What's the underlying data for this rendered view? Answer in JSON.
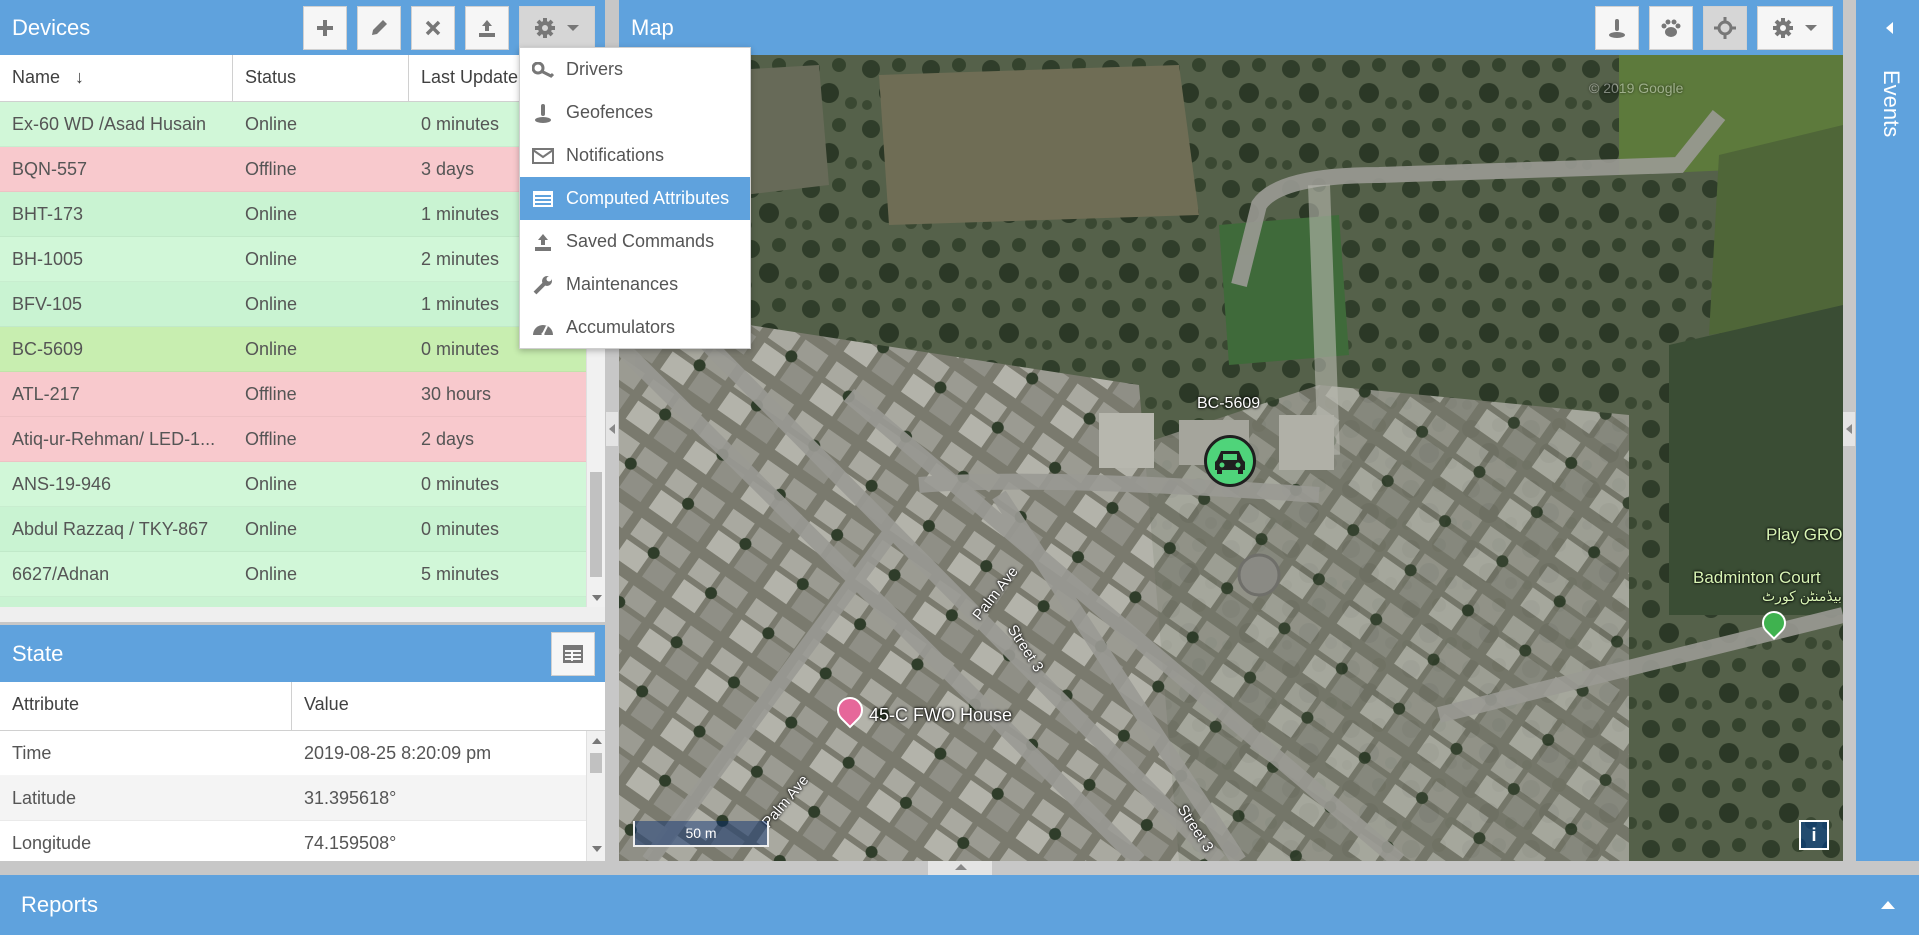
{
  "devices": {
    "title": "Devices",
    "columns": [
      "Name",
      "Status",
      "Last Update"
    ],
    "rows": [
      {
        "name": "Ex-60 WD /Asad Husain",
        "status": "Online",
        "last": "0 minutes"
      },
      {
        "name": "BQN-557",
        "status": "Offline",
        "last": "3 days"
      },
      {
        "name": "BHT-173",
        "status": "Online",
        "last": "1 minutes"
      },
      {
        "name": "BH-1005",
        "status": "Online",
        "last": "2 minutes"
      },
      {
        "name": "BFV-105",
        "status": "Online",
        "last": "1 minutes"
      },
      {
        "name": "BC-5609",
        "status": "Online",
        "last": "0 minutes"
      },
      {
        "name": "ATL-217",
        "status": "Offline",
        "last": "30 hours"
      },
      {
        "name": "Atiq-ur-Rehman/ LED-1...",
        "status": "Offline",
        "last": "2 days"
      },
      {
        "name": "ANS-19-946",
        "status": "Online",
        "last": "0 minutes"
      },
      {
        "name": "Abdul Razzaq / TKY-867",
        "status": "Online",
        "last": "0 minutes"
      },
      {
        "name": "6627/Adnan",
        "status": "Online",
        "last": "5 minutes"
      }
    ]
  },
  "settings_menu": {
    "items": [
      "Drivers",
      "Geofences",
      "Notifications",
      "Computed Attributes",
      "Saved Commands",
      "Maintenances",
      "Accumulators"
    ],
    "active": "Computed Attributes"
  },
  "state": {
    "title": "State",
    "columns": [
      "Attribute",
      "Value"
    ],
    "rows": [
      {
        "attr": "Time",
        "value": "2019-08-25 8:20:09 pm"
      },
      {
        "attr": "Latitude",
        "value": "31.395618°"
      },
      {
        "attr": "Longitude",
        "value": "74.159508°"
      }
    ]
  },
  "map": {
    "title": "Map",
    "device_label": "BC-5609",
    "labels": {
      "house": "45-C FWO House",
      "palm1": "Palm Ave",
      "palm2": "Palm Ave",
      "street1": "Street 3",
      "street2": "Street 3",
      "badminton": "Badminton Court",
      "badminton_urdu": "بیڈمنٹن کورٹ",
      "play": "Play GRO",
      "copyright": "© 2019 Google"
    },
    "scale": "50 m",
    "info": "i"
  },
  "events": {
    "title": "Events"
  },
  "reports": {
    "title": "Reports"
  },
  "colors": {
    "accent": "#5fa2dd",
    "online": "#d1f7d8",
    "offline": "#f8c9cd",
    "selected": "#c8eeb0"
  }
}
